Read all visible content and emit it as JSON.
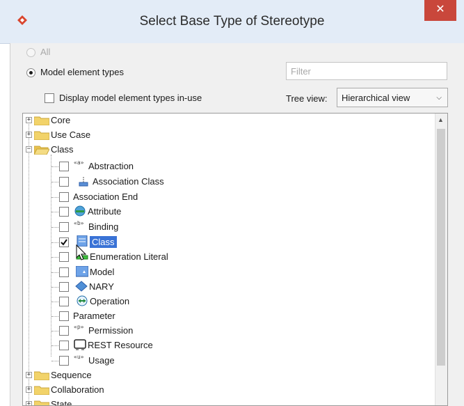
{
  "window": {
    "title": "Select Base Type of Stereotype",
    "close_label": "✕"
  },
  "options": {
    "all_label": "All",
    "model_types_label": "Model element types",
    "in_use_label": "Display model element types in-use",
    "filter_placeholder": "Filter",
    "tree_view_label": "Tree view:",
    "tree_view_value": "Hierarchical view"
  },
  "tree": {
    "core": "Core",
    "use_case": "Use Case",
    "class_folder": "Class",
    "items": [
      {
        "label": "Abstraction",
        "icon": "abstraction-icon",
        "checked": false,
        "stereo": "a"
      },
      {
        "label": "Association Class",
        "icon": "association-class-icon",
        "checked": false
      },
      {
        "label": "Association End",
        "icon": "",
        "checked": false
      },
      {
        "label": "Attribute",
        "icon": "attribute-icon",
        "checked": false
      },
      {
        "label": "Binding",
        "icon": "binding-icon",
        "checked": false,
        "stereo": "b"
      },
      {
        "label": "Class",
        "icon": "class-icon",
        "checked": true
      },
      {
        "label": "Enumeration Literal",
        "icon": "enumeration-literal-icon",
        "checked": false
      },
      {
        "label": "Model",
        "icon": "model-icon",
        "checked": false
      },
      {
        "label": "NARY",
        "icon": "nary-icon",
        "checked": false
      },
      {
        "label": "Operation",
        "icon": "operation-icon",
        "checked": false
      },
      {
        "label": "Parameter",
        "icon": "",
        "checked": false
      },
      {
        "label": "Permission",
        "icon": "permission-icon",
        "checked": false,
        "stereo": "p"
      },
      {
        "label": "REST Resource",
        "icon": "rest-resource-icon",
        "checked": false
      },
      {
        "label": "Usage",
        "icon": "usage-icon",
        "checked": false,
        "stereo": "u"
      }
    ],
    "sequence": "Sequence",
    "collaboration": "Collaboration",
    "state": "State"
  },
  "colors": {
    "selection": "#3a73d6",
    "title_bar": "#e3ecf7",
    "close": "#c9473b",
    "folder": "#f2d36a"
  }
}
